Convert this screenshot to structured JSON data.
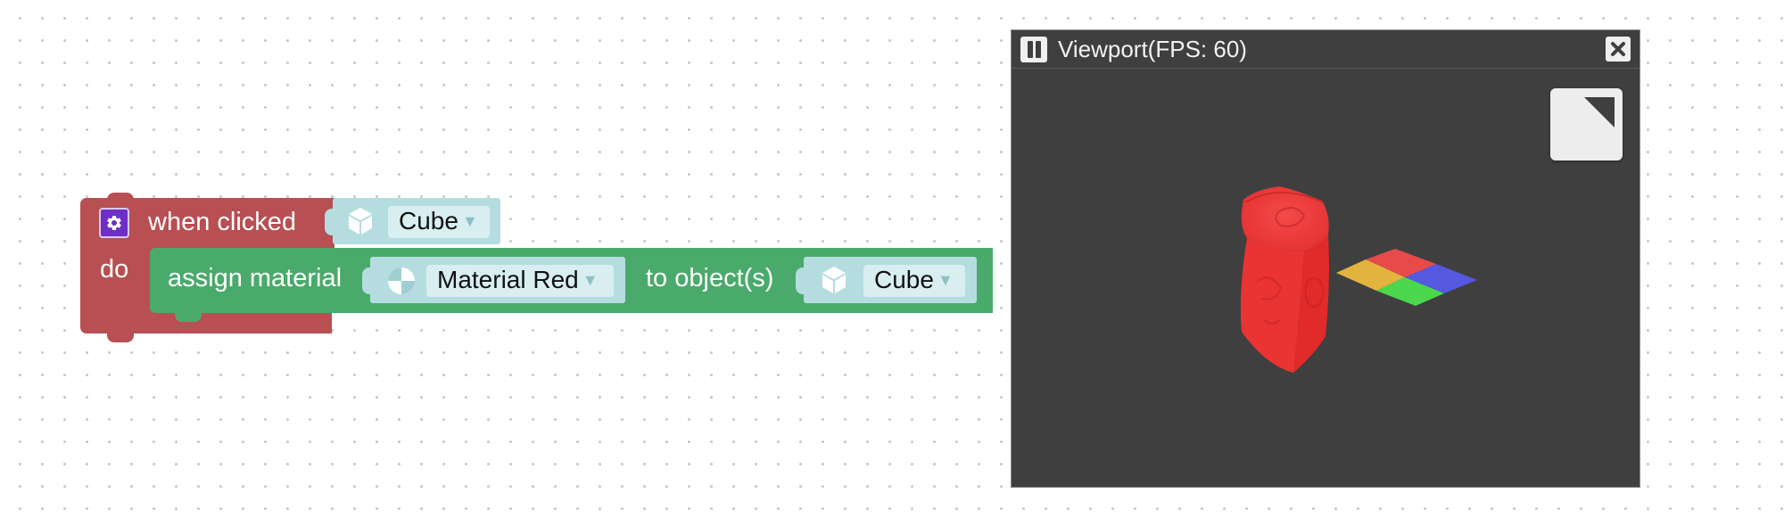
{
  "event_block": {
    "label": "when clicked",
    "do_label": "do",
    "target_object": "Cube",
    "gear_icon": "gear-icon",
    "color": "#b84f52"
  },
  "action_block": {
    "label": "assign material",
    "material": "Material Red",
    "to_label": "to object(s)",
    "target_object": "Cube",
    "color": "#4aaa6b"
  },
  "input_color": "#b5dde0",
  "viewport": {
    "title": "Viewport(FPS: 60)",
    "pause_icon": "pause-icon",
    "close_icon": "close-icon",
    "maximize_icon": "maximize-icon",
    "background": "#3f3f3f",
    "scene": {
      "cube_color": "#ee3333",
      "plane_colors": [
        "#e84a4a",
        "#5558e0",
        "#e2b43e",
        "#4cd84c"
      ]
    }
  }
}
